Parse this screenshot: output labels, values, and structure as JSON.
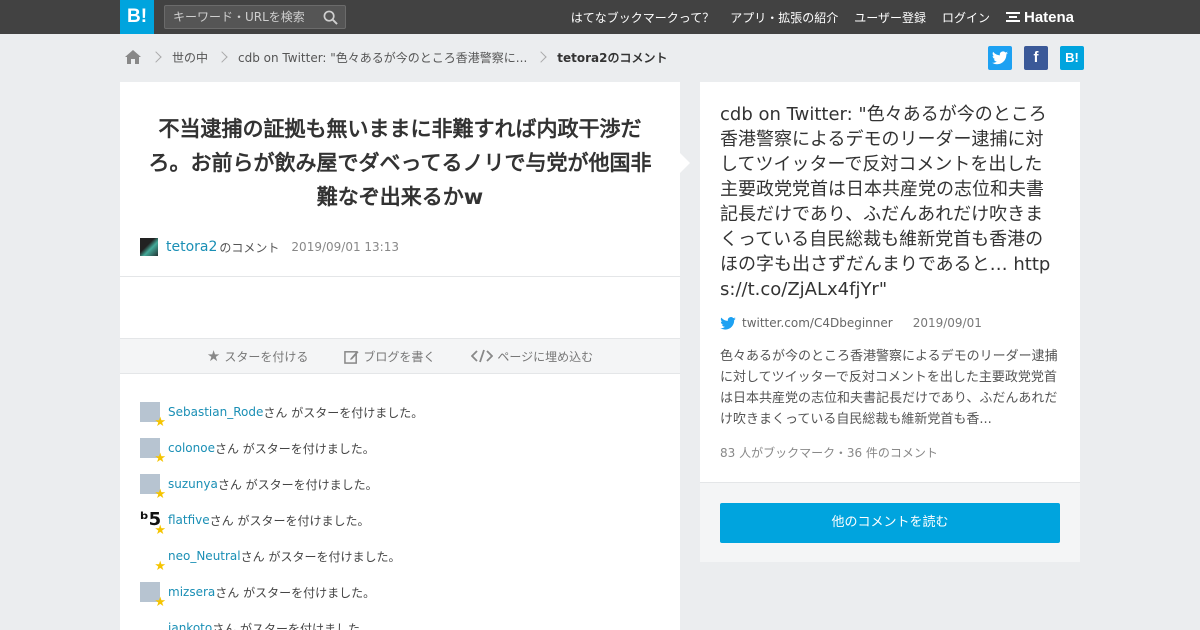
{
  "topbar": {
    "logo": "B!",
    "search_placeholder": "キーワード・URLを検索",
    "nav": [
      "はてなブックマークって？",
      "アプリ・拡張の紹介",
      "ユーザー登録",
      "ログイン"
    ],
    "brand": "Hatena"
  },
  "breadcrumb": {
    "items": [
      "世の中",
      "cdb on Twitter: \"色々あるが今のところ香港警察に...",
      "tetora2のコメント"
    ]
  },
  "share": {
    "twitter_color": "#1da1f2",
    "facebook_color": "#3b5998",
    "hatena_color": "#00a4de",
    "hatena_label": "B!"
  },
  "comment": {
    "text": "不当逮捕の証拠も無いままに非難すれば内政干渉だろ。お前らが飲み屋でダベってるノリで与党が他国非難なぞ出来るかw",
    "user": "tetora2",
    "suffix": "のコメント",
    "date": "2019/09/01 13:13"
  },
  "actions": {
    "star": "スターを付ける",
    "blog": "ブログを書く",
    "embed": "ページに埋め込む"
  },
  "stars": {
    "suffix": "さん がスターを付けました。",
    "users": [
      "Sebastian_Rode",
      "colonoe",
      "suzunya",
      "flatfive",
      "neo_Neutral",
      "mizsera",
      "jankoto"
    ]
  },
  "entry": {
    "title": "cdb on Twitter: \"色々あるが今のところ香港警察によるデモのリーダー逮捕に対してツイッターで反対コメントを出した主要政党党首は日本共産党の志位和夫書記長だけであり、ふだんあれだけ吹きまくっている自民総裁も維新党首も香港のほの字も出さずだんまりであると… https://t.co/ZjALx4fjYr\"",
    "source": "twitter.com/C4Dbeginner",
    "date": "2019/09/01",
    "desc": "色々あるが今のところ香港警察によるデモのリーダー逮捕に対してツイッターで反対コメントを出した主要政党党首は日本共産党の志位和夫書記長だけであり、ふだんあれだけ吹きまくっている自民総裁も維新党首も香...",
    "count": "83 人がブックマーク・36 件のコメント",
    "button": "他のコメントを読む"
  },
  "colors": {
    "accent": "#00a4de",
    "topbar": "#424242",
    "link": "#1a8fb5",
    "star": "#f5c400"
  }
}
